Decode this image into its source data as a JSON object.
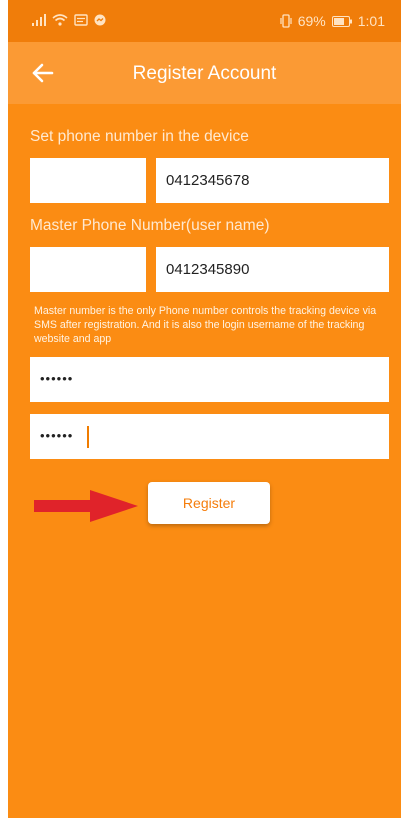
{
  "status_bar": {
    "battery_percent": "69%",
    "time": "1:01"
  },
  "header": {
    "title": "Register Account"
  },
  "form": {
    "device_phone_label": "Set phone number in the device",
    "device_phone_prefix": "",
    "device_phone_value": "0412345678",
    "master_phone_label": "Master Phone Number(user name)",
    "master_phone_prefix": "",
    "master_phone_value": "0412345890",
    "note": "Master number is the only Phone number controls the tracking device via SMS after registration. And it is also the login username of the tracking website and app",
    "password_mask": "••••••",
    "confirm_password_mask": "••••••",
    "register_label": "Register"
  },
  "colors": {
    "background": "#fb8c13",
    "appbar": "#fb9a34",
    "statusbar": "#f07d0a",
    "arrow": "#e0232a"
  }
}
